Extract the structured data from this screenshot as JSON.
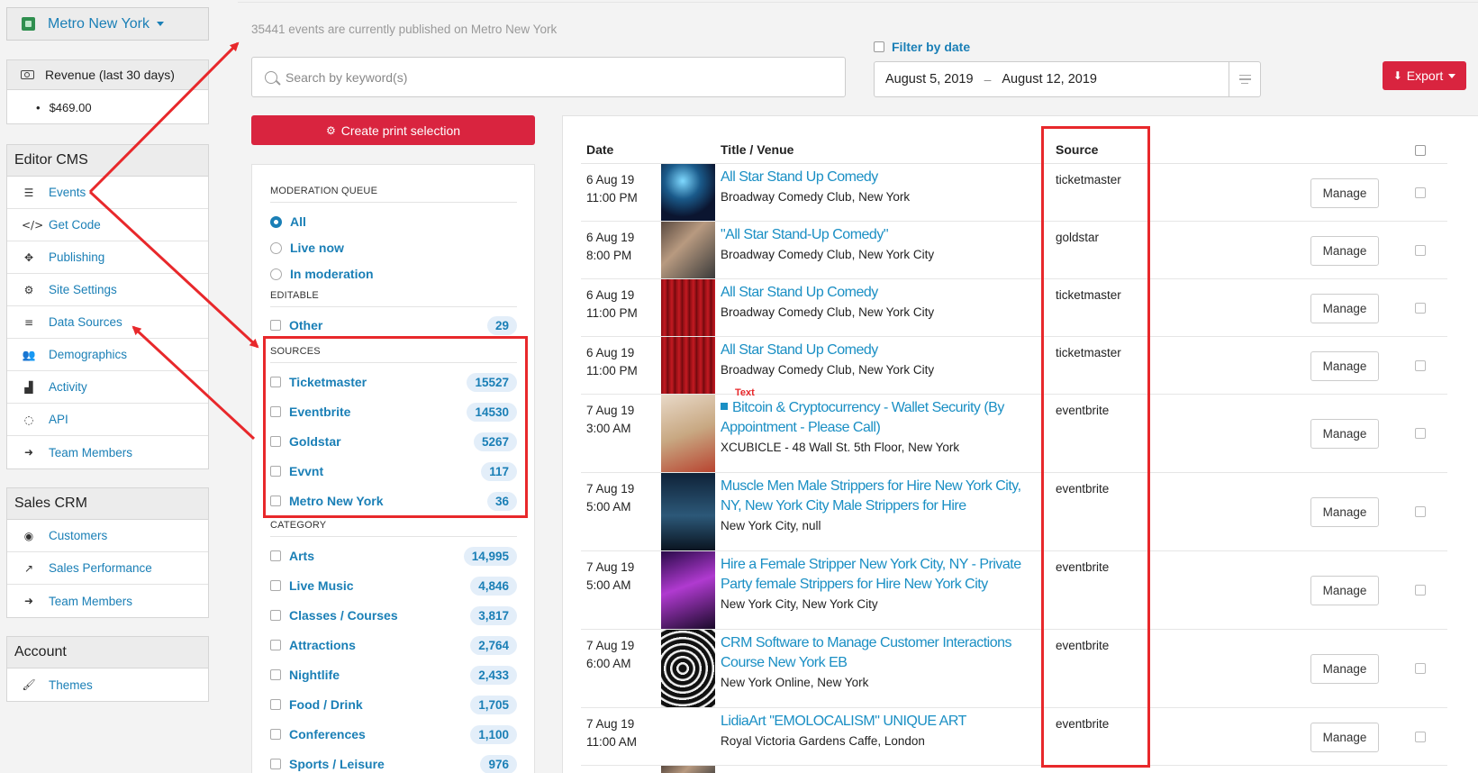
{
  "sidebar": {
    "site": "Metro New York",
    "revenue": {
      "label": "Revenue (last 30 days)",
      "amount": "$469.00"
    },
    "editor_cms": {
      "title": "Editor CMS",
      "items": [
        {
          "label": "Events",
          "icon": "list-icon"
        },
        {
          "label": "Get Code",
          "icon": "code-icon"
        },
        {
          "label": "Publishing",
          "icon": "arrows-icon"
        },
        {
          "label": "Site Settings",
          "icon": "gears-icon"
        },
        {
          "label": "Data Sources",
          "icon": "database-icon"
        },
        {
          "label": "Demographics",
          "icon": "users-icon"
        },
        {
          "label": "Activity",
          "icon": "chart-icon"
        },
        {
          "label": "API",
          "icon": "circle-dot-icon"
        },
        {
          "label": "Team Members",
          "icon": "sign-in-icon"
        }
      ]
    },
    "sales_crm": {
      "title": "Sales CRM",
      "items": [
        {
          "label": "Customers",
          "icon": "user-circle-icon"
        },
        {
          "label": "Sales Performance",
          "icon": "line-chart-icon"
        },
        {
          "label": "Team Members",
          "icon": "sign-in-icon"
        }
      ]
    },
    "account": {
      "title": "Account",
      "items": [
        {
          "label": "Themes",
          "icon": "brush-icon"
        }
      ]
    }
  },
  "header": {
    "published_text": "35441 events are currently published on Metro New York",
    "search_placeholder": "Search by keyword(s)",
    "filter_by_date": "Filter by date",
    "date_from": "August 5, 2019",
    "date_to": "August 12, 2019",
    "date_sep": "–",
    "export_label": "Export",
    "print_selection_label": "Create print selection"
  },
  "filters": {
    "moderation_title": "MODERATION QUEUE",
    "moderation": [
      {
        "label": "All",
        "selected": true
      },
      {
        "label": "Live now",
        "selected": false
      },
      {
        "label": "In moderation",
        "selected": false
      }
    ],
    "editable_title": "EDITABLE",
    "editable": [
      {
        "label": "Other",
        "count": "29"
      }
    ],
    "sources_title": "SOURCES",
    "sources": [
      {
        "label": "Ticketmaster",
        "count": "15527"
      },
      {
        "label": "Eventbrite",
        "count": "14530"
      },
      {
        "label": "Goldstar",
        "count": "5267"
      },
      {
        "label": "Evvnt",
        "count": "117"
      },
      {
        "label": "Metro New York",
        "count": "36"
      }
    ],
    "category_title": "CATEGORY",
    "categories": [
      {
        "label": "Arts",
        "count": "14,995"
      },
      {
        "label": "Live Music",
        "count": "4,846"
      },
      {
        "label": "Classes / Courses",
        "count": "3,817"
      },
      {
        "label": "Attractions",
        "count": "2,764"
      },
      {
        "label": "Nightlife",
        "count": "2,433"
      },
      {
        "label": "Food / Drink",
        "count": "1,705"
      },
      {
        "label": "Conferences",
        "count": "1,100"
      },
      {
        "label": "Sports / Leisure",
        "count": "976"
      }
    ]
  },
  "table": {
    "columns": {
      "date": "Date",
      "title_venue": "Title / Venue",
      "source": "Source"
    },
    "manage_label": "Manage",
    "rows": [
      {
        "date": "6 Aug 19",
        "time": "11:00 PM",
        "title": "All Star Stand Up Comedy",
        "venue": "Broadway Comedy Club, New York",
        "source": "ticketmaster",
        "thumb": "t-stage"
      },
      {
        "date": "6 Aug 19",
        "time": "8:00 PM",
        "title": "\"All Star Stand-Up Comedy\"",
        "venue": "Broadway Comedy Club, New York City",
        "source": "goldstar",
        "thumb": "t-photo"
      },
      {
        "date": "6 Aug 19",
        "time": "11:00 PM",
        "title": "All Star Stand Up Comedy",
        "venue": "Broadway Comedy Club, New York City",
        "source": "ticketmaster",
        "thumb": "t-curtain"
      },
      {
        "date": "6 Aug 19",
        "time": "11:00 PM",
        "title": "All Star Stand Up Comedy",
        "venue": "Broadway Comedy Club, New York City",
        "source": "ticketmaster",
        "thumb": "t-curtain"
      },
      {
        "date": "7 Aug 19",
        "time": "3:00 AM",
        "title": "Bitcoin & Cryptocurrency - Wallet Security (By Appointment - Please Call)",
        "venue": "XCUBICLE - 48 Wall St. 5th Floor, New York",
        "source": "eventbrite",
        "thumb": "t-room"
      },
      {
        "date": "7 Aug 19",
        "time": "5:00 AM",
        "title": "Muscle Men Male Strippers for Hire New York City, NY, New York City Male Strippers for Hire",
        "venue": "New York City, null",
        "source": "eventbrite",
        "thumb": "t-men"
      },
      {
        "date": "7 Aug 19",
        "time": "5:00 AM",
        "title": "Hire a Female Stripper New York City, NY - Private Party female Strippers for Hire New York City",
        "venue": "New York City, New York City",
        "source": "eventbrite",
        "thumb": "t-neon"
      },
      {
        "date": "7 Aug 19",
        "time": "6:00 AM",
        "title": "CRM Software to Manage Customer Interactions Course New York EB",
        "venue": "New York Online, New York",
        "source": "eventbrite",
        "thumb": "t-maze"
      },
      {
        "date": "7 Aug 19",
        "time": "11:00 AM",
        "title": "LidiaArt \"EMOLOCALISM\" UNIQUE ART",
        "venue": "Royal Victoria Gardens Caffe, London",
        "source": "eventbrite",
        "thumb": ""
      }
    ]
  },
  "annotations": {
    "text_label": "Text"
  }
}
